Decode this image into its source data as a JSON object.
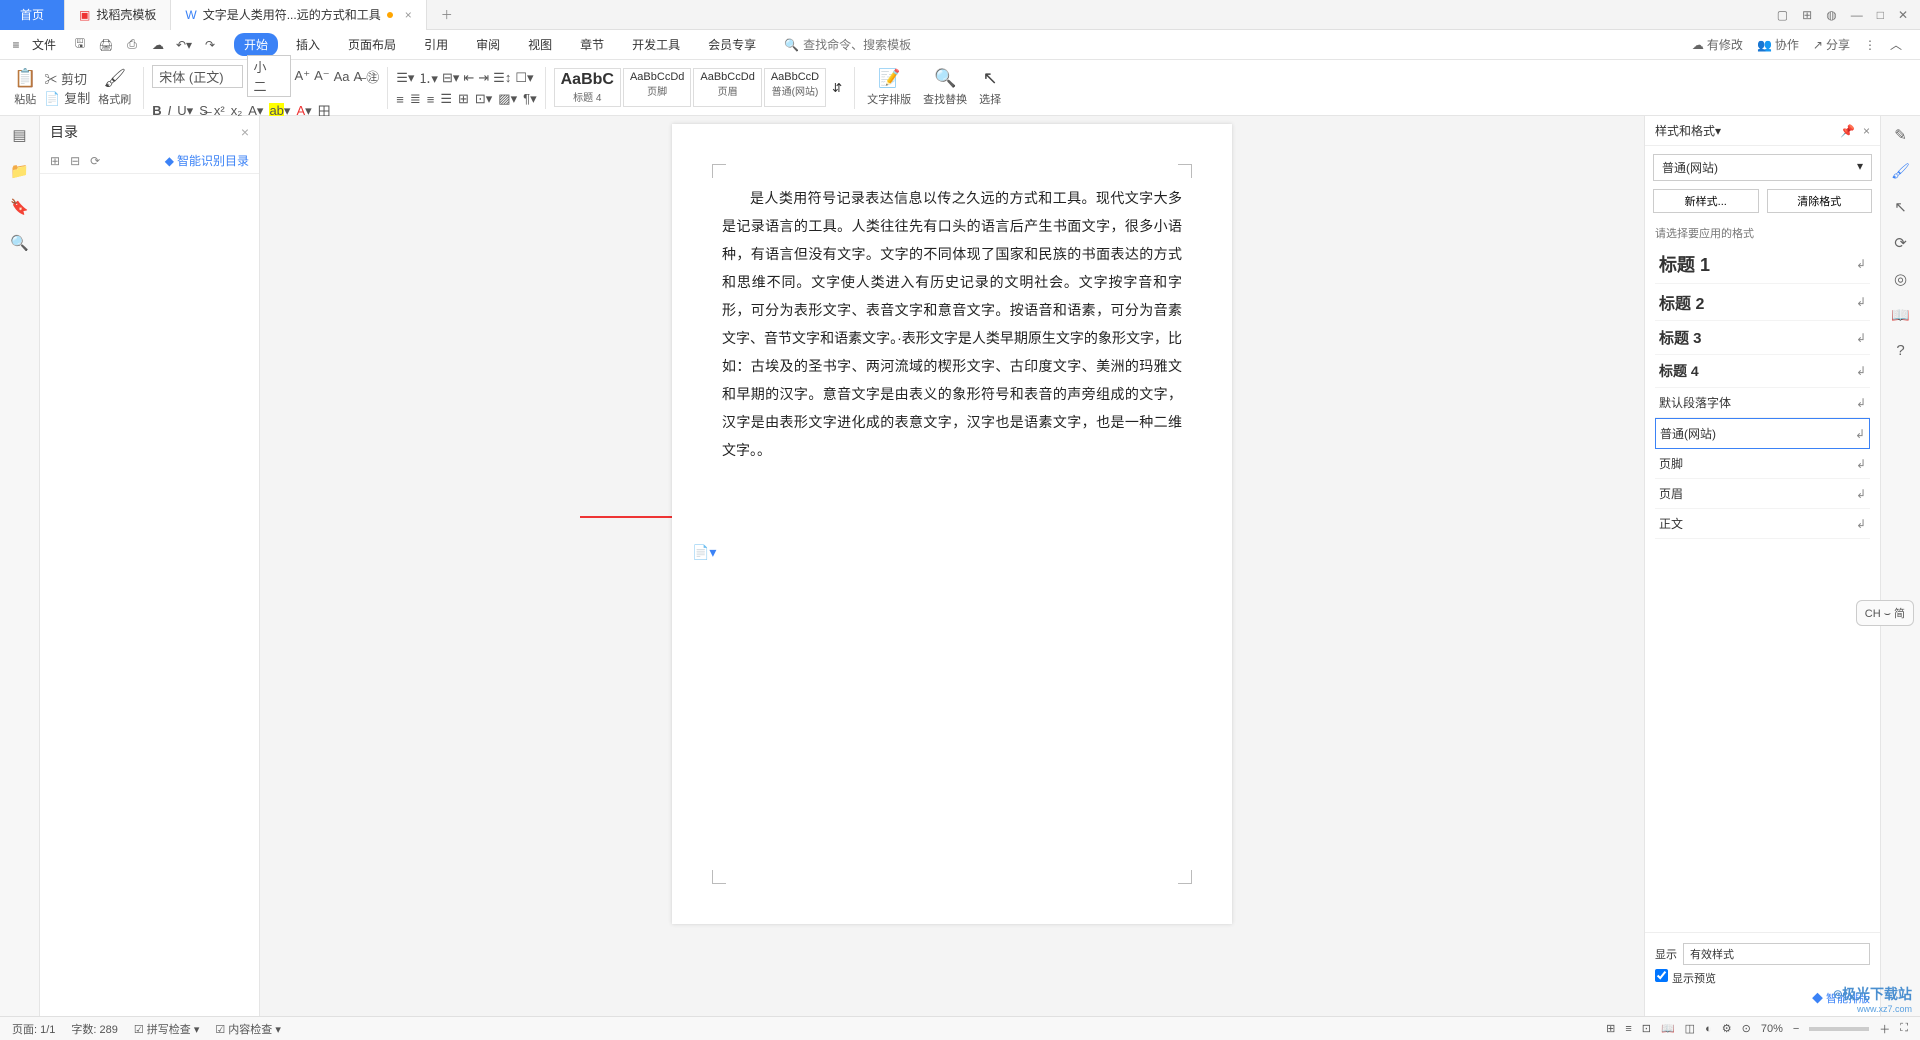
{
  "tabs": {
    "home": "首页",
    "t1": "找稻壳模板",
    "t2": "文字是人类用符...远的方式和工具"
  },
  "menu": {
    "file": "文件",
    "items": [
      "开始",
      "插入",
      "页面布局",
      "引用",
      "审阅",
      "视图",
      "章节",
      "开发工具",
      "会员专享"
    ],
    "searchPlaceholder": "查找命令、搜索模板"
  },
  "rightTop": {
    "changes": "有修改",
    "coop": "协作",
    "share": "分享"
  },
  "ribbon": {
    "paste": "粘贴",
    "cut": "剪切",
    "copy": "复制",
    "brush": "格式刷",
    "font": "宋体 (正文)",
    "size": "小二",
    "styles": [
      {
        "prev": "AaBbC",
        "lbl": "标题 4"
      },
      {
        "prev": "AaBbCcDd",
        "lbl": "页脚"
      },
      {
        "prev": "AaBbCcDd",
        "lbl": "页眉"
      },
      {
        "prev": "AaBbCcD",
        "lbl": "普通(网站)"
      }
    ],
    "layout": "文字排版",
    "find": "查找替换",
    "select": "选择"
  },
  "toc": {
    "title": "目录",
    "smart": "智能识别目录"
  },
  "document": {
    "body": "是人类用符号记录表达信息以传之久远的方式和工具。现代文字大多是记录语言的工具。人类往往先有口头的语言后产生书面文字，很多小语种，有语言但没有文字。文字的不同体现了国家和民族的书面表达的方式和思维不同。文字使人类进入有历史记录的文明社会。文字按字音和字形，可分为表形文字、表音文字和意音文字。按语音和语素，可分为音素文字、音节文字和语素文字。·表形文字是人类早期原生文字的象形文字，比如：古埃及的圣书字、两河流域的楔形文字、古印度文字、美洲的玛雅文和早期的汉字。意音文字是由表义的象形符号和表音的声旁组成的文字，汉字是由表形文字进化成的表意文字，汉字也是语素文字，也是一种二维文字。。"
  },
  "stylePanel": {
    "title": "样式和格式",
    "current": "普通(网站)",
    "newBtn": "新样式...",
    "clearBtn": "清除格式",
    "hint": "请选择要应用的格式",
    "items": [
      {
        "name": "标题 1",
        "cls": "h1"
      },
      {
        "name": "标题 2",
        "cls": "h2"
      },
      {
        "name": "标题 3",
        "cls": "h3"
      },
      {
        "name": "标题 4",
        "cls": "h4"
      },
      {
        "name": "默认段落字体",
        "cls": ""
      },
      {
        "name": "普通(网站)",
        "cls": "selected"
      },
      {
        "name": "页脚",
        "cls": ""
      },
      {
        "name": "页眉",
        "cls": ""
      },
      {
        "name": "正文",
        "cls": ""
      }
    ],
    "showLbl": "显示",
    "showVal": "有效样式",
    "previewChk": "显示预览",
    "smartLayout": "智能排版"
  },
  "status": {
    "page": "页面: 1/1",
    "words": "字数: 289",
    "spell": "拼写检查",
    "content": "内容检查",
    "zoom": "70%"
  },
  "misc": {
    "ch": "CH ⌣ 简"
  },
  "brand": {
    "l1": "⌾极光下载站",
    "l2": "www.xz7.com"
  }
}
